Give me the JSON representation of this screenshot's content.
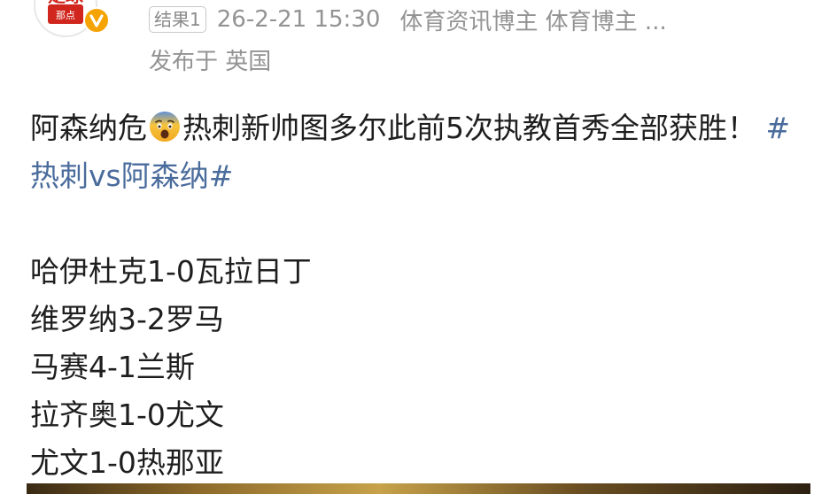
{
  "author": {
    "avatar_text": "足球",
    "avatar_subtext": "那点",
    "verified_icon": "v-badge-icon"
  },
  "meta": {
    "tag": "结果1",
    "time": "26-2-21 15:30",
    "intro": "体育资讯博主 体育博主 ...",
    "location": "发布于 英国"
  },
  "post": {
    "headline_before_emoji": "阿森纳危",
    "emoji": "fearful-face-emoji",
    "headline_after_emoji": "热刺新帅图多尔此前5次执教首秀全部获胜！",
    "hashtag": "#热刺vs阿森纳#",
    "results": [
      "哈伊杜克1-0瓦拉日丁",
      "维罗纳3-2罗马",
      "马赛4-1兰斯",
      "拉齐奥1-0尤文",
      "尤文1-0热那亚"
    ]
  },
  "colors": {
    "hashtag": "#4a6c9c",
    "meta_text": "#939393",
    "verified_badge": "#f5a300",
    "avatar_red": "#d0261d"
  }
}
